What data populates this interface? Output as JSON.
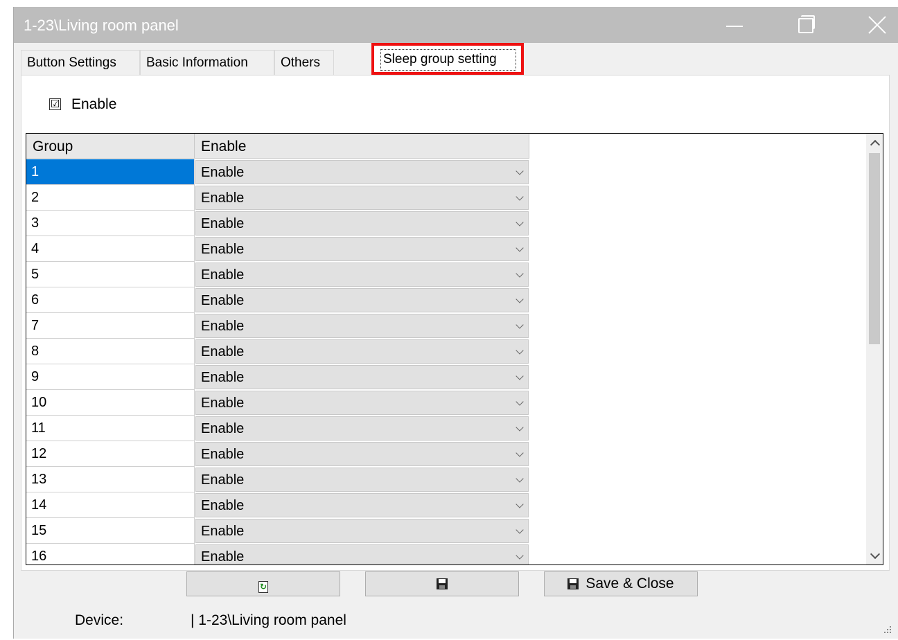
{
  "window": {
    "title": "1-23\\Living room panel"
  },
  "tabs": [
    {
      "label": "Button Settings"
    },
    {
      "label": "Basic Information"
    },
    {
      "label": "Others"
    },
    {
      "label": "Sleep group setting",
      "active": true
    }
  ],
  "panel": {
    "enable_checkbox": {
      "label": "Enable",
      "checked": true,
      "mark": "☑"
    },
    "grid": {
      "columns": [
        "Group",
        "Enable"
      ],
      "rows": [
        {
          "group": "1",
          "enable": "Enable",
          "selected": true
        },
        {
          "group": "2",
          "enable": "Enable"
        },
        {
          "group": "3",
          "enable": "Enable"
        },
        {
          "group": "4",
          "enable": "Enable"
        },
        {
          "group": "5",
          "enable": "Enable"
        },
        {
          "group": "6",
          "enable": "Enable"
        },
        {
          "group": "7",
          "enable": "Enable"
        },
        {
          "group": "8",
          "enable": "Enable"
        },
        {
          "group": "9",
          "enable": "Enable"
        },
        {
          "group": "10",
          "enable": "Enable"
        },
        {
          "group": "11",
          "enable": "Enable"
        },
        {
          "group": "12",
          "enable": "Enable"
        },
        {
          "group": "13",
          "enable": "Enable"
        },
        {
          "group": "14",
          "enable": "Enable"
        },
        {
          "group": "15",
          "enable": "Enable"
        },
        {
          "group": "16",
          "enable": "Enable"
        }
      ]
    }
  },
  "buttons": {
    "refresh_icon": "refresh-icon",
    "save_icon": "floppy-disk-icon",
    "save_close_label": "Save & Close"
  },
  "footer": {
    "device_label": "Device:",
    "device_value": "| 1-23\\Living room panel"
  },
  "colors": {
    "highlight": "#ee1111",
    "selection": "#0078d7",
    "titlebar": "#bdbdbd"
  }
}
